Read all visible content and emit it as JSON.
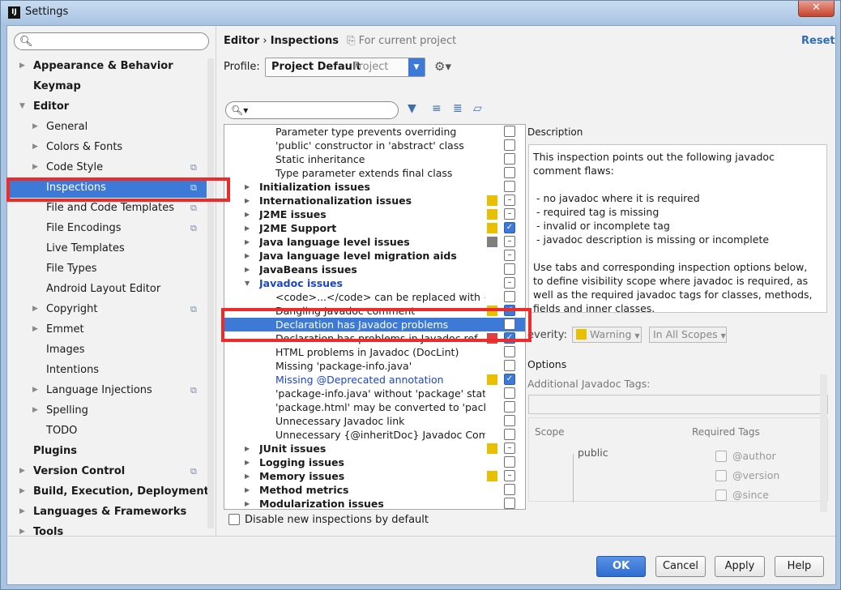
{
  "window": {
    "title": "Settings",
    "app_icon": "IJ",
    "close_label": "✕"
  },
  "sidebar": {
    "search_placeholder": "",
    "items": [
      {
        "label": "Appearance & Behavior",
        "bold": true,
        "arrow": true,
        "indent": 0,
        "copy": false,
        "selected": false
      },
      {
        "label": "Keymap",
        "bold": true,
        "arrow": false,
        "indent": 0,
        "copy": false,
        "selected": false
      },
      {
        "label": "Editor",
        "bold": true,
        "arrow": true,
        "expanded": true,
        "indent": 0,
        "copy": false,
        "selected": false
      },
      {
        "label": "General",
        "bold": false,
        "arrow": true,
        "indent": 1,
        "copy": false,
        "selected": false
      },
      {
        "label": "Colors & Fonts",
        "bold": false,
        "arrow": true,
        "indent": 1,
        "copy": false,
        "selected": false
      },
      {
        "label": "Code Style",
        "bold": false,
        "arrow": true,
        "indent": 1,
        "copy": true,
        "selected": false
      },
      {
        "label": "Inspections",
        "bold": false,
        "arrow": false,
        "indent": 1,
        "copy": true,
        "selected": true
      },
      {
        "label": "File and Code Templates",
        "bold": false,
        "arrow": false,
        "indent": 1,
        "copy": true,
        "selected": false
      },
      {
        "label": "File Encodings",
        "bold": false,
        "arrow": false,
        "indent": 1,
        "copy": true,
        "selected": false
      },
      {
        "label": "Live Templates",
        "bold": false,
        "arrow": false,
        "indent": 1,
        "copy": false,
        "selected": false
      },
      {
        "label": "File Types",
        "bold": false,
        "arrow": false,
        "indent": 1,
        "copy": false,
        "selected": false
      },
      {
        "label": "Android Layout Editor",
        "bold": false,
        "arrow": false,
        "indent": 1,
        "copy": false,
        "selected": false
      },
      {
        "label": "Copyright",
        "bold": false,
        "arrow": true,
        "indent": 1,
        "copy": true,
        "selected": false
      },
      {
        "label": "Emmet",
        "bold": false,
        "arrow": true,
        "indent": 1,
        "copy": false,
        "selected": false
      },
      {
        "label": "Images",
        "bold": false,
        "arrow": false,
        "indent": 1,
        "copy": false,
        "selected": false
      },
      {
        "label": "Intentions",
        "bold": false,
        "arrow": false,
        "indent": 1,
        "copy": false,
        "selected": false
      },
      {
        "label": "Language Injections",
        "bold": false,
        "arrow": true,
        "indent": 1,
        "copy": true,
        "selected": false
      },
      {
        "label": "Spelling",
        "bold": false,
        "arrow": true,
        "indent": 1,
        "copy": false,
        "selected": false
      },
      {
        "label": "TODO",
        "bold": false,
        "arrow": false,
        "indent": 1,
        "copy": false,
        "selected": false
      },
      {
        "label": "Plugins",
        "bold": true,
        "arrow": false,
        "indent": 0,
        "copy": false,
        "selected": false
      },
      {
        "label": "Version Control",
        "bold": true,
        "arrow": true,
        "indent": 0,
        "copy": true,
        "selected": false
      },
      {
        "label": "Build, Execution, Deployment",
        "bold": true,
        "arrow": true,
        "indent": 0,
        "copy": false,
        "selected": false
      },
      {
        "label": "Languages & Frameworks",
        "bold": true,
        "arrow": true,
        "indent": 0,
        "copy": false,
        "selected": false
      },
      {
        "label": "Tools",
        "bold": true,
        "arrow": true,
        "indent": 0,
        "copy": false,
        "selected": false
      }
    ]
  },
  "breadcrumb": {
    "part1": "Editor",
    "separator": "›",
    "part2": "Inspections",
    "scope": "For current project"
  },
  "reset_label": "Reset",
  "profile": {
    "label": "Profile:",
    "name": "Project Default",
    "kind": "Project"
  },
  "inspections": {
    "search_placeholder": "",
    "rows": [
      {
        "text": "Parameter type prevents overriding",
        "level": 2,
        "bold": false,
        "arrow": "",
        "sev": "",
        "cb": "empty"
      },
      {
        "text": "'public' constructor in 'abstract' class",
        "level": 2,
        "bold": false,
        "arrow": "",
        "sev": "",
        "cb": "empty"
      },
      {
        "text": "Static inheritance",
        "level": 2,
        "bold": false,
        "arrow": "",
        "sev": "",
        "cb": "empty"
      },
      {
        "text": "Type parameter extends final class",
        "level": 2,
        "bold": false,
        "arrow": "",
        "sev": "",
        "cb": "empty"
      },
      {
        "text": "Initialization issues",
        "level": 1,
        "bold": true,
        "arrow": "right",
        "sev": "",
        "cb": "empty"
      },
      {
        "text": "Internationalization issues",
        "level": 1,
        "bold": true,
        "arrow": "right",
        "sev": "#e8c000",
        "cb": "partial"
      },
      {
        "text": "J2ME issues",
        "level": 1,
        "bold": true,
        "arrow": "right",
        "sev": "#e8c000",
        "cb": "partial"
      },
      {
        "text": "J2ME Support",
        "level": 1,
        "bold": true,
        "arrow": "right",
        "sev": "#e8c000",
        "cb": "checked"
      },
      {
        "text": "Java language level issues",
        "level": 1,
        "bold": true,
        "arrow": "right",
        "sev": "#7f7f7f",
        "cb": "partial"
      },
      {
        "text": "Java language level migration aids",
        "level": 1,
        "bold": true,
        "arrow": "right",
        "sev": "",
        "cb": "partial"
      },
      {
        "text": "JavaBeans issues",
        "level": 1,
        "bold": true,
        "arrow": "right",
        "sev": "",
        "cb": "empty"
      },
      {
        "text": "Javadoc issues",
        "level": 1,
        "bold": true,
        "arrow": "down",
        "sev": "",
        "cb": "partial",
        "blue": true
      },
      {
        "text": "<code>...</code> can be replaced with {@c",
        "level": 2,
        "bold": false,
        "arrow": "",
        "sev": "",
        "cb": "empty"
      },
      {
        "text": "Dangling Javadoc comment",
        "level": 2,
        "bold": false,
        "arrow": "",
        "sev": "#e8c000",
        "cb": "checked"
      },
      {
        "text": "Declaration has Javadoc problems",
        "level": 2,
        "bold": false,
        "arrow": "",
        "sev": "",
        "cb": "empty",
        "selected": true
      },
      {
        "text": "Declaration has problems in Javadoc ref",
        "level": 2,
        "bold": false,
        "arrow": "",
        "sev": "#e04040",
        "cb": "checked"
      },
      {
        "text": "HTML problems in Javadoc (DocLint)",
        "level": 2,
        "bold": false,
        "arrow": "",
        "sev": "",
        "cb": "empty"
      },
      {
        "text": "Missing 'package-info.java'",
        "level": 2,
        "bold": false,
        "arrow": "",
        "sev": "",
        "cb": "empty"
      },
      {
        "text": "Missing @Deprecated annotation",
        "level": 2,
        "bold": false,
        "arrow": "",
        "sev": "#e8c000",
        "cb": "checked",
        "blue": true
      },
      {
        "text": "'package-info.java' without 'package' statem",
        "level": 2,
        "bold": false,
        "arrow": "",
        "sev": "",
        "cb": "empty"
      },
      {
        "text": "'package.html' may be converted to 'packag",
        "level": 2,
        "bold": false,
        "arrow": "",
        "sev": "",
        "cb": "empty"
      },
      {
        "text": "Unnecessary Javadoc link",
        "level": 2,
        "bold": false,
        "arrow": "",
        "sev": "",
        "cb": "empty"
      },
      {
        "text": "Unnecessary {@inheritDoc} Javadoc Comme",
        "level": 2,
        "bold": false,
        "arrow": "",
        "sev": "",
        "cb": "empty"
      },
      {
        "text": "JUnit issues",
        "level": 1,
        "bold": true,
        "arrow": "right",
        "sev": "#e8c000",
        "cb": "partial"
      },
      {
        "text": "Logging issues",
        "level": 1,
        "bold": true,
        "arrow": "right",
        "sev": "",
        "cb": "empty"
      },
      {
        "text": "Memory issues",
        "level": 1,
        "bold": true,
        "arrow": "right",
        "sev": "#e8c000",
        "cb": "partial"
      },
      {
        "text": "Method metrics",
        "level": 1,
        "bold": true,
        "arrow": "right",
        "sev": "",
        "cb": "empty"
      },
      {
        "text": "Modularization issues",
        "level": 1,
        "bold": true,
        "arrow": "right",
        "sev": "",
        "cb": "empty"
      }
    ]
  },
  "disable_new_label": "Disable new inspections by default",
  "description": {
    "label": "Description",
    "paragraphs": [
      "This inspection points out the following javadoc comment flaws:",
      "",
      " - no javadoc where it is required",
      " - required tag is missing",
      " - invalid or incomplete tag",
      " - javadoc description is missing or incomplete",
      "",
      "Use tabs and corresponding inspection options below, to define visibility scope where javadoc is required, as well as the required javadoc tags for classes, methods, fields and inner classes."
    ]
  },
  "severity": {
    "label": "everity:",
    "value": "Warning",
    "color": "#e8c000",
    "scope": "In All Scopes"
  },
  "options": {
    "label": "Options",
    "additional_tags_label": "Additional Javadoc Tags:",
    "scope_header": "Scope",
    "required_tags_header": "Required Tags",
    "scope_value": "public",
    "required_tags": [
      "@author",
      "@version",
      "@since"
    ]
  },
  "buttons": {
    "ok": "OK",
    "cancel": "Cancel",
    "apply": "Apply",
    "help": "Help"
  }
}
